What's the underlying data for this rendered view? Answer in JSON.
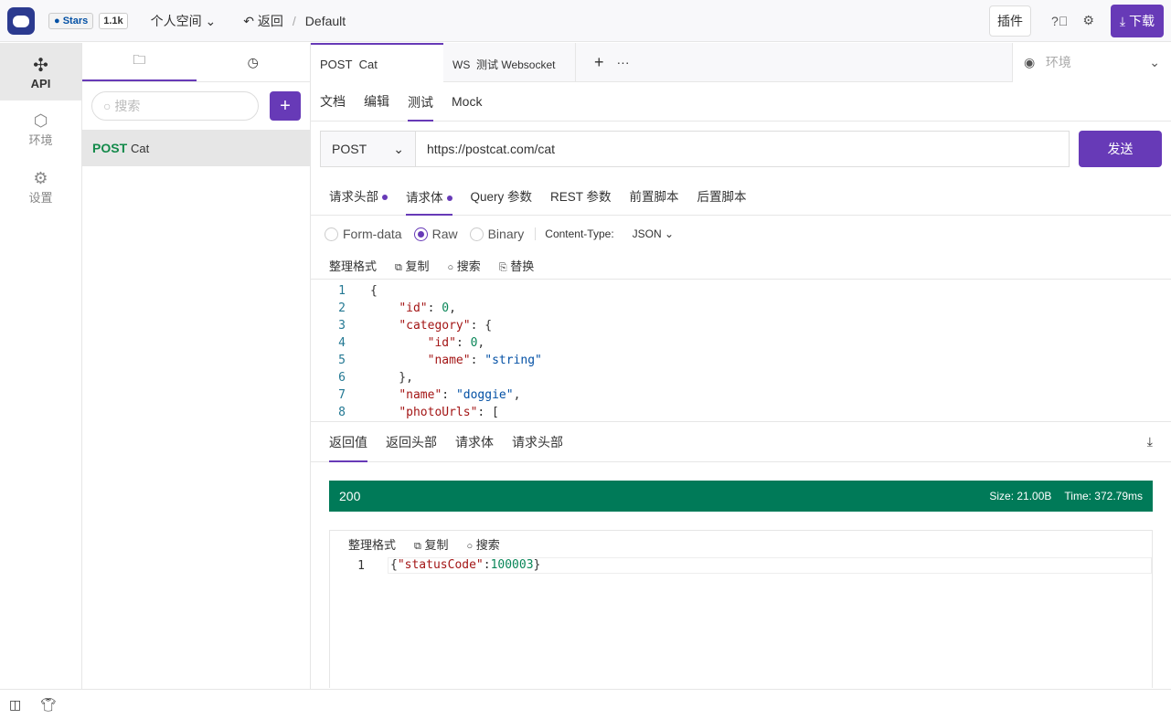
{
  "header": {
    "stars_label": "Stars",
    "stars_count": "1.1k",
    "workspace": "个人空间",
    "back": "返回",
    "separator": "/",
    "project": "Default",
    "plugins": "插件",
    "download": "下载"
  },
  "nav": [
    {
      "label": "API"
    },
    {
      "label": "环境"
    },
    {
      "label": "设置"
    }
  ],
  "sidebar": {
    "search_placeholder": "搜索",
    "add": "+",
    "items": [
      {
        "method": "POST",
        "name": "Cat"
      }
    ]
  },
  "tabs": [
    {
      "method": "POST",
      "name": "Cat"
    },
    {
      "method": "WS",
      "name": "测试 Websocket"
    }
  ],
  "tab_actions": {
    "add": "+",
    "more": "···"
  },
  "env": {
    "placeholder": "环境"
  },
  "subtabs": [
    "文档",
    "编辑",
    "测试",
    "Mock"
  ],
  "request": {
    "method": "POST",
    "url": "https://postcat.com/cat",
    "send": "发送"
  },
  "req_tabs": [
    "请求头部",
    "请求体",
    "Query 参数",
    "REST 参数",
    "前置脚本",
    "后置脚本"
  ],
  "body_types": [
    "Form-data",
    "Raw",
    "Binary"
  ],
  "content_type_label": "Content-Type:",
  "content_type": "JSON",
  "editor_tools": [
    "整理格式",
    "复制",
    "搜索",
    "替换"
  ],
  "code_lines": [
    "{",
    "    \"id\": 0,",
    "    \"category\": {",
    "        \"id\": 0,",
    "        \"name\": \"string\"",
    "    },",
    "    \"name\": \"doggie\",",
    "    \"photoUrls\": ["
  ],
  "resp_tabs": [
    "返回值",
    "返回头部",
    "请求体",
    "请求头部"
  ],
  "response": {
    "status": "200",
    "size": "Size: 21.00B",
    "time": "Time: 372.79ms",
    "status_color": "#007a58",
    "tools": [
      "整理格式",
      "复制",
      "搜索"
    ],
    "lines": [
      "{\"statusCode\":100003}"
    ]
  }
}
